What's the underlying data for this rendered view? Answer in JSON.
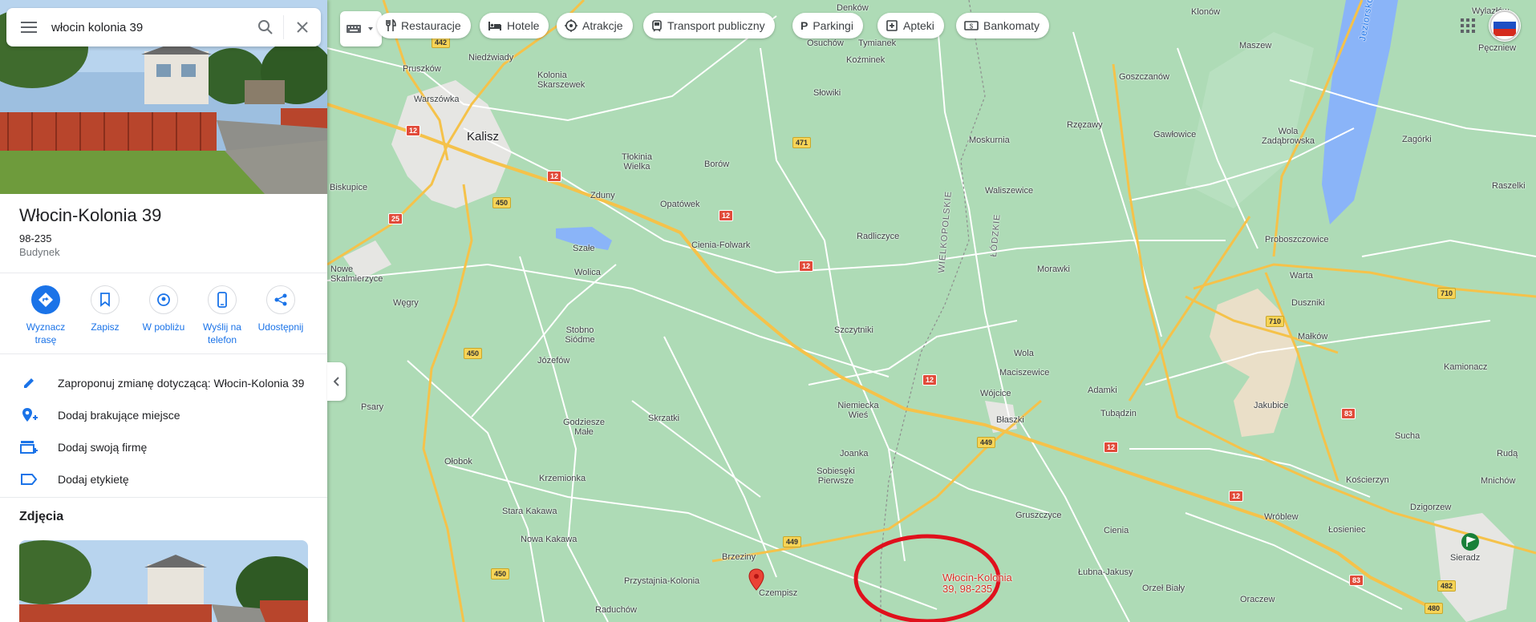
{
  "search": {
    "query": "włocin kolonia 39"
  },
  "place": {
    "title": "Włocin-Kolonia 39",
    "postal": "98-235",
    "category": "Budynek"
  },
  "actions": [
    {
      "label1": "Wyznacz",
      "label2": "trasę"
    },
    {
      "label1": "Zapisz",
      "label2": ""
    },
    {
      "label1": "W pobliżu",
      "label2": ""
    },
    {
      "label1": "Wyślij na",
      "label2": "telefon"
    },
    {
      "label1": "Udostępnij",
      "label2": ""
    }
  ],
  "rows": [
    "Zaproponuj zmianę dotyczącą: Włocin-Kolonia 39",
    "Dodaj brakujące miejsce",
    "Dodaj swoją firmę",
    "Dodaj etykietę"
  ],
  "photos_heading": "Zdjęcia",
  "chips": [
    "Restauracje",
    "Hotele",
    "Atrakcje",
    "Transport publiczny",
    "Parkingi",
    "Apteki",
    "Bankomaty"
  ],
  "pin_label": {
    "line1": "Włocin-Kolonia",
    "line2": "39, 98-235"
  },
  "map_labels": {
    "kalisz": "Kalisz",
    "lake": "Jeziorsko",
    "wlkp": "WIELKOPOLSKIE",
    "lodz": "ŁÓDZKIE",
    "places": [
      "Denków",
      "Osuchów",
      "Tymianek",
      "Koźminek",
      "Pruszków",
      "Niedźwiady",
      "Kolonia Skarszewek",
      "Warszówka",
      "Słowiki",
      "Goszczanów",
      "Maszew",
      "Klonów",
      "Wylazłów",
      "Pęczniew",
      "Rzęzawy",
      "Gawłowice",
      "Wola Zadąbrowska",
      "Zagórki",
      "Raszelki",
      "Moskurnia",
      "Tłokinia Wielka",
      "Borów",
      "Zduny",
      "Opatówek",
      "Waliszewice",
      "Biskupice",
      "Cienia-Folwark",
      "Radliczyce",
      "Proboszczowice",
      "Szałe",
      "Morawki",
      "Warta",
      "Nowe Skalmierzyce",
      "Wolica",
      "Węgry",
      "Duszniki",
      "Szczytniki",
      "Stobno Siódme",
      "Józefów",
      "Wola",
      "Maciszewice",
      "Małków",
      "Kamionacz",
      "Adamki",
      "Wójcice",
      "Psary",
      "Niemiecka Wieś",
      "Błaszki",
      "Jakubice",
      "Tubądzin",
      "Godziesze Małe",
      "Skrzatki",
      "Sucha",
      "Rudą",
      "Ołobok",
      "Joanka",
      "Krzemionka",
      "Sobiesęki Pierwsze",
      "Mnichów",
      "Kościerzyn",
      "Stara Kakawa",
      "Gruszczyce",
      "Cienia",
      "Dzigorzew",
      "Wróblew",
      "Łosieniec",
      "Nowa Kakawa",
      "Brzeziny",
      "Sieradz",
      "Łubna-Jakusy",
      "Przystajnia-Kolonia",
      "Czempisz",
      "Orzeł Biały",
      "Oraczew",
      "Raduchów"
    ]
  },
  "road_numbers": [
    "442",
    "12",
    "471",
    "12",
    "12",
    "12",
    "450",
    "25",
    "12",
    "450",
    "449",
    "12",
    "12",
    "449",
    "450",
    "710",
    "710",
    "83",
    "83",
    "482",
    "480"
  ]
}
